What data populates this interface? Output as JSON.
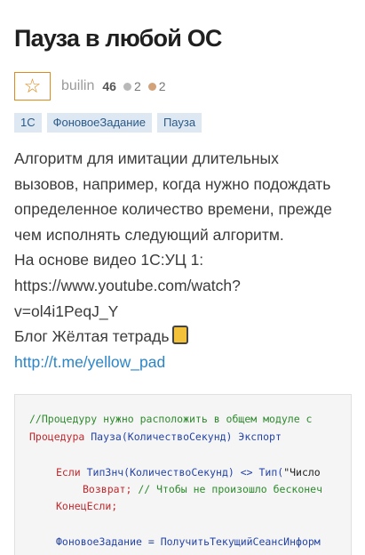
{
  "article": {
    "title": "Пауза в любой ОС",
    "author": "builin",
    "rating": "46",
    "silver_count": "2",
    "bronze_count": "2",
    "favorite_icon": "star-icon",
    "tags": [
      "1С",
      "ФоновоеЗадание",
      "Пауза"
    ],
    "description": {
      "line1": "Алгоритм для имитации длительных",
      "line2": "вызовов, например, когда нужно подождать",
      "line3": "определенное количество времени, прежде",
      "line4": "чем исполнять следующий алгоритм.",
      "line5": "На основе видео 1С:УЦ 1:",
      "line6": "https://www.youtube.com/watch?",
      "line7": "v=ol4i1PeqJ_Y",
      "blog_label": "Блог Жёлтая тетрадь",
      "blog_icon": "folder-icon",
      "blog_link": "http://t.me/yellow_pad"
    }
  },
  "code": {
    "line1": "//Процедуру нужно расположить в общем модуле с",
    "line2_kw": "Процедура",
    "line2_rest": " Пауза(КоличествоСекунд) Экспорт",
    "line3_kw": "Если",
    "line3_id": " ТипЗнч(КоличествоСекунд) <> Тип(",
    "line3_str": "\"Число",
    "line4_kw": "Возврат;",
    "line4_comment": " // Чтобы не произошло бесконеч",
    "line5_kw": "КонецЕсли;",
    "line6": "ФоновоеЗадание = ПолучитьТекущийСеансИнформ"
  },
  "colors": {
    "accent_orange": "#e08a1e",
    "tag_bg": "#dde8f3",
    "link": "#2a86c9",
    "silver": "#b9b9b9",
    "bronze": "#d2a27a"
  }
}
